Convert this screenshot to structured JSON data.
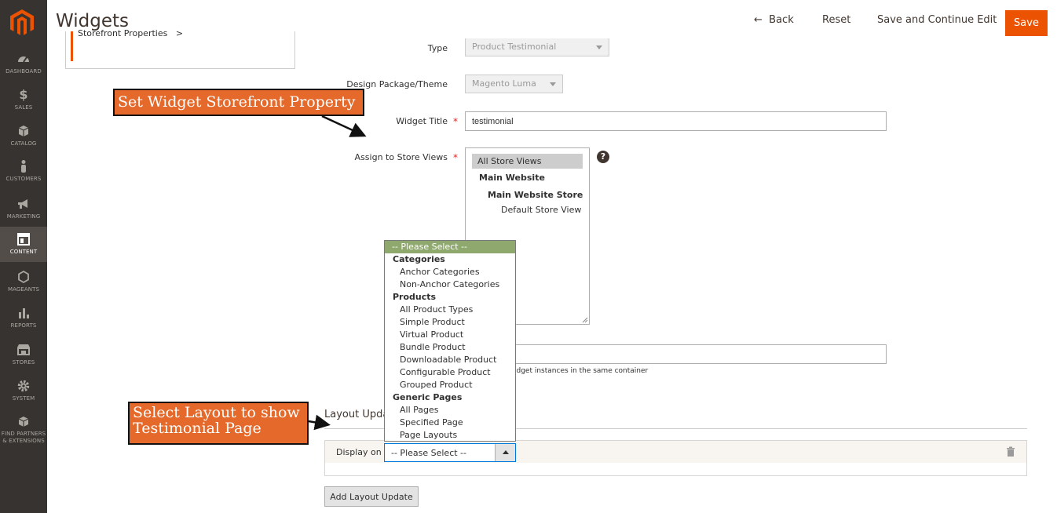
{
  "header": {
    "title": "Widgets",
    "back_label": "Back",
    "reset_label": "Reset",
    "save_continue_label": "Save and Continue Edit",
    "save_label": "Save"
  },
  "sidebar": {
    "items": [
      {
        "label": "DASHBOARD",
        "icon": "dashboard-icon"
      },
      {
        "label": "SALES",
        "icon": "dollar-icon"
      },
      {
        "label": "CATALOG",
        "icon": "box-icon"
      },
      {
        "label": "CUSTOMERS",
        "icon": "person-icon"
      },
      {
        "label": "MARKETING",
        "icon": "megaphone-icon"
      },
      {
        "label": "CONTENT",
        "icon": "content-icon"
      },
      {
        "label": "MAGEANTS",
        "icon": "hexagon-icon"
      },
      {
        "label": "REPORTS",
        "icon": "bar-chart-icon"
      },
      {
        "label": "STORES",
        "icon": "store-icon"
      },
      {
        "label": "SYSTEM",
        "icon": "gear-icon"
      },
      {
        "label_line1": "FIND PARTNERS",
        "label_line2": "& EXTENSIONS",
        "icon": "cube-icon"
      }
    ]
  },
  "tabs": {
    "storefront_properties": "Storefront Properties"
  },
  "form": {
    "type_label": "Type",
    "type_value": "Product Testimonial",
    "design_label": "Design Package/Theme",
    "design_value": "Magento Luma",
    "title_label": "Widget Title",
    "title_value": "testimonial",
    "store_views_label": "Assign to Store Views",
    "store_views": {
      "all": "All Store Views",
      "website": "Main Website",
      "store": "Main Website Store",
      "view": "Default Store View"
    },
    "help_glyph": "?",
    "sort_hint": "idget instances in the same container"
  },
  "layout_updates": {
    "title": "Layout Upda",
    "display_on_label": "Display on",
    "display_on_value": "-- Please Select --",
    "add_button": "Add Layout Update"
  },
  "dropdown": {
    "selected": "-- Please Select --",
    "groups": [
      {
        "label": "Categories",
        "items": [
          "Anchor Categories",
          "Non-Anchor Categories"
        ]
      },
      {
        "label": "Products",
        "items": [
          "All Product Types",
          "Simple Product",
          "Virtual Product",
          "Bundle Product",
          "Downloadable Product",
          "Configurable Product",
          "Grouped Product"
        ]
      },
      {
        "label": "Generic Pages",
        "items": [
          "All Pages",
          "Specified Page",
          "Page Layouts"
        ]
      }
    ]
  },
  "callouts": {
    "storefront": "Set Widget Storefront Property",
    "layout_line1": "Select Layout to show",
    "layout_line2": "Testimonial Page"
  },
  "colors": {
    "accent": "#eb5202",
    "sidebar": "#373330",
    "callout": "#e4692a",
    "dropdown_selected": "#8fa86d"
  }
}
